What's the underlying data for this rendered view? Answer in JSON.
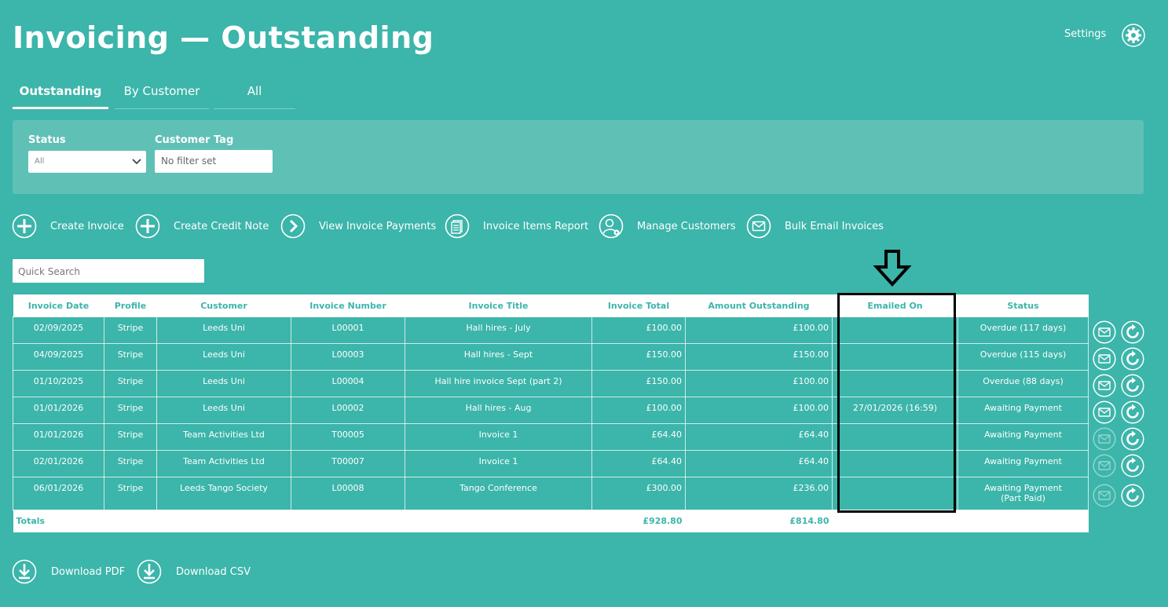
{
  "colors": {
    "background": "#3cb5aa",
    "panel": "#5fc0b6",
    "header_text": "#3cb5aa",
    "annotation": "#000000"
  },
  "page": {
    "title": "Invoicing — Outstanding"
  },
  "header": {
    "settings_label": "Settings",
    "settings_icon": "gear-icon"
  },
  "tabs": [
    {
      "label": "Outstanding",
      "active": true
    },
    {
      "label": "By Customer",
      "active": false
    },
    {
      "label": "All",
      "active": false
    }
  ],
  "filters": {
    "status_label": "Status",
    "status_value": "All",
    "tag_label": "Customer Tag",
    "tag_value": "No filter set"
  },
  "actions": [
    {
      "label": "Create Invoice",
      "icon": "plus-circle-icon"
    },
    {
      "label": "Create Credit Note",
      "icon": "plus-circle-icon"
    },
    {
      "label": "View Invoice Payments",
      "icon": "chevron-right-circle-icon"
    },
    {
      "label": "Invoice Items Report",
      "icon": "report-icon"
    },
    {
      "label": "Manage Customers",
      "icon": "user-settings-icon"
    },
    {
      "label": "Bulk Email Invoices",
      "icon": "envelope-circle-icon"
    }
  ],
  "search": {
    "placeholder": "Quick Search"
  },
  "table": {
    "columns": [
      "Invoice Date",
      "Profile",
      "Customer",
      "Invoice Number",
      "Invoice Title",
      "Invoice Total",
      "Amount Outstanding",
      "Emailed On",
      "Status"
    ],
    "rows": [
      {
        "date": "02/09/2025",
        "profile": "Stripe",
        "customer": "Leeds Uni",
        "number": "L00001",
        "title": "Hall hires - July",
        "total": "£100.00",
        "outstanding": "£100.00",
        "emailed": "",
        "status": "Overdue (117 days)",
        "status2": "",
        "email_enabled": true
      },
      {
        "date": "04/09/2025",
        "profile": "Stripe",
        "customer": "Leeds Uni",
        "number": "L00003",
        "title": "Hall hires - Sept",
        "total": "£150.00",
        "outstanding": "£150.00",
        "emailed": "",
        "status": "Overdue (115 days)",
        "status2": "",
        "email_enabled": true
      },
      {
        "date": "01/10/2025",
        "profile": "Stripe",
        "customer": "Leeds Uni",
        "number": "L00004",
        "title": "Hall hire invoice Sept (part 2)",
        "total": "£150.00",
        "outstanding": "£100.00",
        "emailed": "",
        "status": "Overdue (88 days)",
        "status2": "",
        "email_enabled": true
      },
      {
        "date": "01/01/2026",
        "profile": "Stripe",
        "customer": "Leeds Uni",
        "number": "L00002",
        "title": "Hall hires - Aug",
        "total": "£100.00",
        "outstanding": "£100.00",
        "emailed": "27/01/2026 (16:59)",
        "status": "Awaiting Payment",
        "status2": "",
        "email_enabled": true
      },
      {
        "date": "01/01/2026",
        "profile": "Stripe",
        "customer": "Team Activities Ltd",
        "number": "T00005",
        "title": "Invoice 1",
        "total": "£64.40",
        "outstanding": "£64.40",
        "emailed": "",
        "status": "Awaiting Payment",
        "status2": "",
        "email_enabled": false
      },
      {
        "date": "02/01/2026",
        "profile": "Stripe",
        "customer": "Team Activities Ltd",
        "number": "T00007",
        "title": "Invoice 1",
        "total": "£64.40",
        "outstanding": "£64.40",
        "emailed": "",
        "status": "Awaiting Payment",
        "status2": "",
        "email_enabled": false
      },
      {
        "date": "06/01/2026",
        "profile": "Stripe",
        "customer": "Leeds Tango Society",
        "number": "L00008",
        "title": "Tango Conference",
        "total": "£300.00",
        "outstanding": "£236.00",
        "emailed": "",
        "status": "Awaiting Payment",
        "status2": "(Part Paid)",
        "email_enabled": false
      }
    ],
    "totals": {
      "label": "Totals",
      "total": "£928.80",
      "outstanding": "£814.80"
    }
  },
  "downloads": [
    {
      "label": "Download PDF",
      "icon": "download-circle-icon"
    },
    {
      "label": "Download CSV",
      "icon": "download-circle-icon"
    }
  ]
}
